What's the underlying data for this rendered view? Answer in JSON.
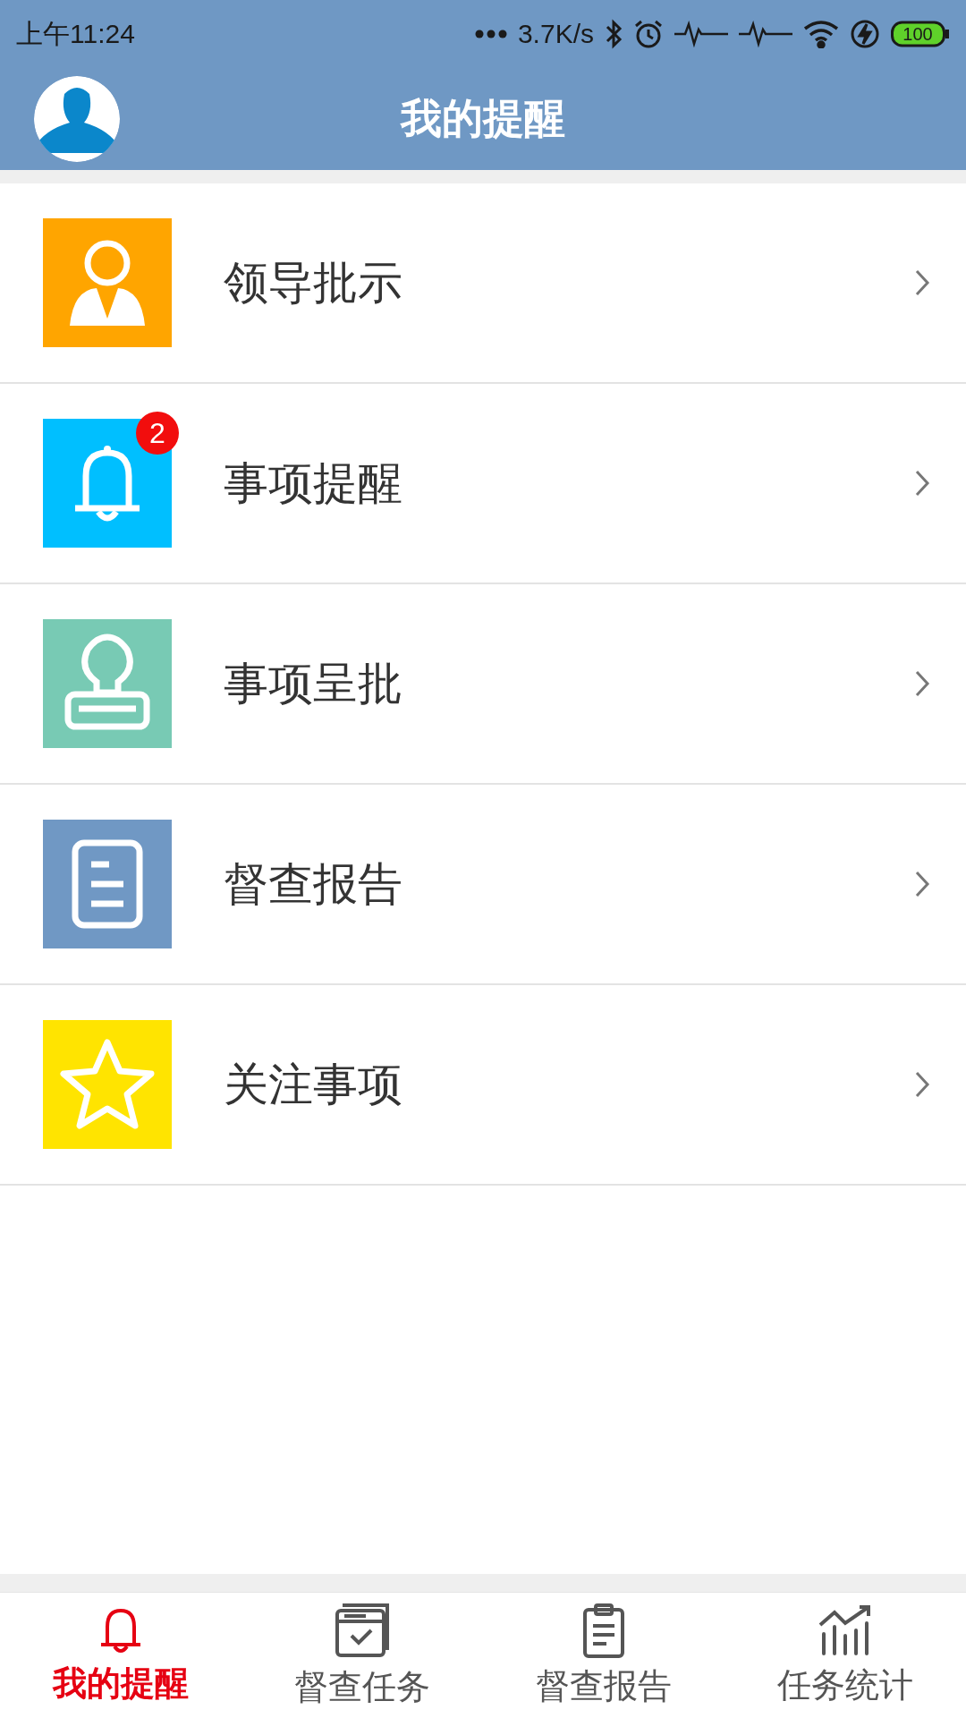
{
  "status_bar": {
    "time": "上午11:24",
    "speed": "3.7K/s",
    "battery": "100"
  },
  "header": {
    "title": "我的提醒"
  },
  "menu": [
    {
      "label": "领导批示",
      "kind": "person",
      "color": "#ffa500"
    },
    {
      "label": "事项提醒",
      "kind": "bell",
      "color": "#00bfff",
      "badge": "2"
    },
    {
      "label": "事项呈批",
      "kind": "stamp",
      "color": "#78cab4"
    },
    {
      "label": "督查报告",
      "kind": "document",
      "color": "#7098c4"
    },
    {
      "label": "关注事项",
      "kind": "star",
      "color": "#ffe400"
    }
  ],
  "tabs": [
    {
      "label": "我的提醒",
      "kind": "bell",
      "selected": true
    },
    {
      "label": "督查任务",
      "kind": "calendar",
      "selected": false
    },
    {
      "label": "督查报告",
      "kind": "clipboard",
      "selected": false
    },
    {
      "label": "任务统计",
      "kind": "chart",
      "selected": false
    }
  ]
}
